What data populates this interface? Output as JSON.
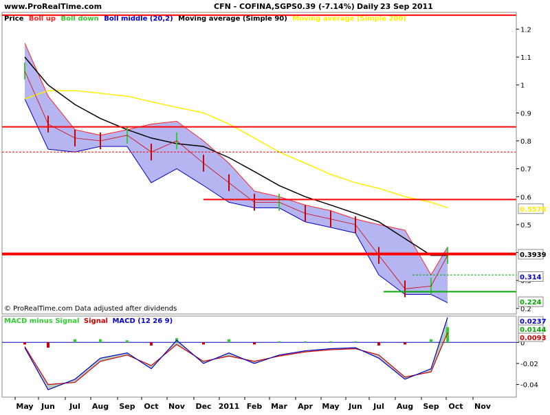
{
  "header": {
    "site": "www.ProRealTime.com",
    "title": "CFN - COFINA,SGPS",
    "price": "0.39 (-7.14%)",
    "period": "Daily",
    "date": "23 Sep 2011"
  },
  "legend": {
    "price": "Price",
    "boll_up": "Boll up",
    "boll_down": "Boll down",
    "boll_middle": "Boll middle (20,2)",
    "ma90": "Moving average (Simple 90)",
    "ma200": "Moving average (Simple 200)"
  },
  "footer_note": "© ProRealTime.com  Data adjusted after dividends",
  "macd_legend": {
    "hist": "MACD minus Signal",
    "signal": "Signal",
    "macd": "MACD (12 26 9)"
  },
  "colors": {
    "bull": "#33cc33",
    "bear": "#cc0000",
    "band_fill": "#a8a8ee",
    "ma90": "#000000",
    "ma200": "#ffee00",
    "boll_up": "#ff2222",
    "boll_mid": "#0000cc",
    "support_green": "#00aa00"
  },
  "chart_data": [
    {
      "type": "line",
      "name": "price",
      "x_labels": [
        "May",
        "Jun",
        "Jul",
        "Aug",
        "Sep",
        "Oct",
        "Nov",
        "Dec",
        "2011",
        "Feb",
        "Mar",
        "Apr",
        "May",
        "Jun",
        "Jul",
        "Aug",
        "Sep",
        "Oct",
        "Nov"
      ],
      "y_ticks": [
        1.2,
        1.1,
        1.0,
        0.9,
        0.8,
        0.7,
        0.6,
        0.5,
        0.4,
        0.3,
        0.2
      ],
      "ylim": [
        0.18,
        1.26
      ],
      "x": [
        "May",
        "Jun",
        "Jul",
        "Aug",
        "Sep",
        "Oct",
        "Nov",
        "Dec",
        "2011",
        "Feb",
        "Mar",
        "Apr",
        "May",
        "Jun",
        "Jul",
        "Aug",
        "Sep",
        "Sep 23"
      ],
      "close": [
        1.05,
        0.86,
        0.81,
        0.8,
        0.82,
        0.76,
        0.8,
        0.72,
        0.65,
        0.58,
        0.58,
        0.54,
        0.52,
        0.5,
        0.39,
        0.27,
        0.28,
        0.39
      ],
      "boll_up": [
        1.15,
        0.96,
        0.84,
        0.82,
        0.84,
        0.86,
        0.87,
        0.8,
        0.72,
        0.62,
        0.6,
        0.57,
        0.55,
        0.52,
        0.5,
        0.48,
        0.32,
        0.42
      ],
      "boll_down": [
        0.95,
        0.77,
        0.76,
        0.78,
        0.78,
        0.65,
        0.7,
        0.64,
        0.58,
        0.56,
        0.56,
        0.51,
        0.49,
        0.47,
        0.32,
        0.25,
        0.25,
        0.22
      ],
      "ma90": [
        1.1,
        1.0,
        0.93,
        0.88,
        0.84,
        0.81,
        0.79,
        0.78,
        0.74,
        0.69,
        0.64,
        0.6,
        0.57,
        0.54,
        0.51,
        0.45,
        0.39,
        0.39
      ],
      "ma200": [
        0.95,
        0.98,
        0.98,
        0.97,
        0.96,
        0.94,
        0.92,
        0.9,
        0.86,
        0.81,
        0.76,
        0.72,
        0.68,
        0.65,
        0.63,
        0.6,
        0.58,
        0.56
      ],
      "hlines": [
        {
          "value": 1.25,
          "color": "#ff0000",
          "style": "solid"
        },
        {
          "value": 0.85,
          "color": "#ff0000",
          "style": "solid"
        },
        {
          "value": 0.76,
          "color": "#ff0000",
          "style": "dotted"
        },
        {
          "value": 0.59,
          "color": "#ff0000",
          "style": "solid",
          "start": "Dec"
        },
        {
          "value": 0.395,
          "color": "#ff0000",
          "style": "solid"
        },
        {
          "value": 0.32,
          "color": "#00aa00",
          "style": "dotted",
          "start": "Sep"
        },
        {
          "value": 0.26,
          "color": "#00aa00",
          "style": "solid",
          "start": "Jul"
        }
      ],
      "value_labels": [
        {
          "text": "0.5578",
          "color": "#ffee00",
          "value": 0.557
        },
        {
          "text": "0.3939",
          "color": "#000000",
          "value": 0.3939
        },
        {
          "text": "0.314",
          "color": "#0000cc",
          "value": 0.314
        },
        {
          "text": "0.224",
          "color": "#00aa00",
          "value": 0.224
        }
      ]
    },
    {
      "type": "bar",
      "name": "macd",
      "y_ticks": [
        "0",
        "-0.02",
        "-0.04"
      ],
      "ylim": [
        -0.052,
        0.025
      ],
      "x": [
        "May",
        "Jun",
        "Jul",
        "Aug",
        "Sep",
        "Oct",
        "Nov",
        "Dec",
        "2011",
        "Feb",
        "Mar",
        "Apr",
        "May",
        "Jun",
        "Jul",
        "Aug",
        "Sep",
        "Sep 23"
      ],
      "macd": [
        -0.005,
        -0.045,
        -0.035,
        -0.015,
        -0.01,
        -0.025,
        0.002,
        -0.02,
        -0.01,
        -0.02,
        -0.012,
        -0.008,
        -0.006,
        -0.005,
        -0.015,
        -0.035,
        -0.025,
        0.0237
      ],
      "signal": [
        -0.004,
        -0.04,
        -0.038,
        -0.018,
        -0.012,
        -0.022,
        -0.002,
        -0.018,
        -0.013,
        -0.018,
        -0.013,
        -0.009,
        -0.007,
        -0.006,
        -0.012,
        -0.033,
        -0.028,
        0.0093
      ],
      "histogram": [
        -0.002,
        -0.005,
        0.003,
        0.003,
        0.002,
        -0.003,
        0.004,
        -0.002,
        0.003,
        -0.002,
        0.001,
        0.001,
        0.001,
        0.001,
        -0.003,
        -0.002,
        0.003,
        0.0144
      ],
      "value_labels": [
        {
          "text": "0.0237",
          "color": "#0000cc"
        },
        {
          "text": "0.0144",
          "color": "#00aa00"
        },
        {
          "text": "0.0093",
          "color": "#cc0000"
        }
      ]
    }
  ]
}
